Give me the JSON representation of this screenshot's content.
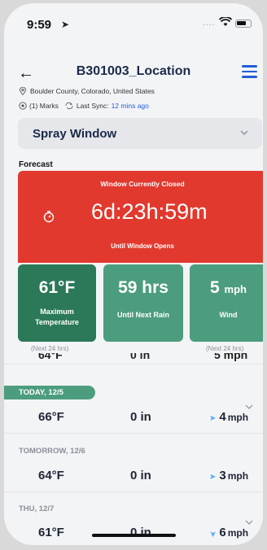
{
  "status_bar": {
    "time": "9:59",
    "dots": "...."
  },
  "header": {
    "title": "B301003_Location",
    "location": "Boulder County, Colorado, United States",
    "marks": "(1) Marks",
    "last_sync_label": "Last Sync:",
    "last_sync_value": "12 mins ago"
  },
  "dropdown": {
    "selected": "Spray Window"
  },
  "forecast": {
    "label": "Forecast",
    "window_status": "Window Currently Closed",
    "countdown": "6d:23h:59m",
    "until_text": "Until Window Opens"
  },
  "tiles": [
    {
      "value": "61°F",
      "label_line1": "Maximum",
      "label_line2": "Temperature",
      "note": "(Next 24 hrs)"
    },
    {
      "value": "59 hrs",
      "label_line1": "Until Next Rain"
    },
    {
      "value": "5",
      "unit": "mph",
      "label_line1": "Wind",
      "note": "(Next 24 hrs)"
    }
  ],
  "rows": [
    {
      "header": "TODAY, 12/5",
      "temp": "66°F",
      "rain": "0 in",
      "wind": "4",
      "unit": "mph"
    },
    {
      "header": "TOMORROW, 12/6",
      "temp": "64°F",
      "rain": "0 in",
      "wind": "3",
      "unit": "mph"
    },
    {
      "header": "THU, 12/7",
      "temp": "61°F",
      "rain": "0 in",
      "wind": "6",
      "unit": "mph"
    }
  ],
  "partial_row": {
    "temp": "64°F",
    "rain": "0 in",
    "wind": "5 mph"
  },
  "colors": {
    "accent": "#1f5fd6",
    "closed_red": "#e2392e",
    "green_dark": "#2b7959",
    "green": "#4c9d7e"
  }
}
